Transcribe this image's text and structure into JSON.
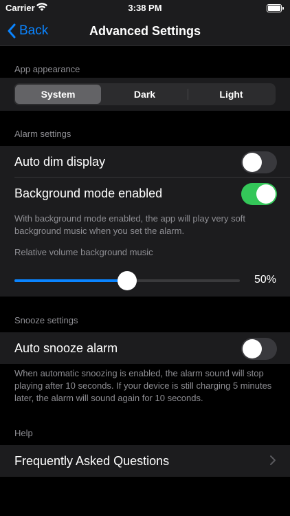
{
  "status": {
    "carrier": "Carrier",
    "time": "3:38 PM"
  },
  "nav": {
    "back_label": "Back",
    "title": "Advanced Settings"
  },
  "appearance": {
    "header": "App appearance",
    "options": [
      "System",
      "Dark",
      "Light"
    ],
    "selected": "System"
  },
  "alarm": {
    "header": "Alarm settings",
    "auto_dim_label": "Auto dim display",
    "auto_dim_on": false,
    "background_mode_label": "Background mode enabled",
    "background_mode_on": true,
    "footer": "With background mode enabled, the app will play very soft background music when you set the alarm.",
    "volume_label": "Relative volume background music",
    "volume_value": 0.5,
    "volume_text": "50%"
  },
  "snooze": {
    "header": "Snooze settings",
    "auto_snooze_label": "Auto snooze alarm",
    "auto_snooze_on": false,
    "footer": "When automatic snoozing is enabled, the alarm sound will stop playing after 10 seconds. If your device is still charging 5 minutes later, the alarm will sound again for 10 seconds."
  },
  "help": {
    "header": "Help",
    "faq_label": "Frequently Asked Questions"
  },
  "colors": {
    "accent": "#0a84ff",
    "toggle_on": "#34c759",
    "background": "#000000",
    "cell": "#1c1c1e",
    "secondary_text": "#8e8e93"
  }
}
